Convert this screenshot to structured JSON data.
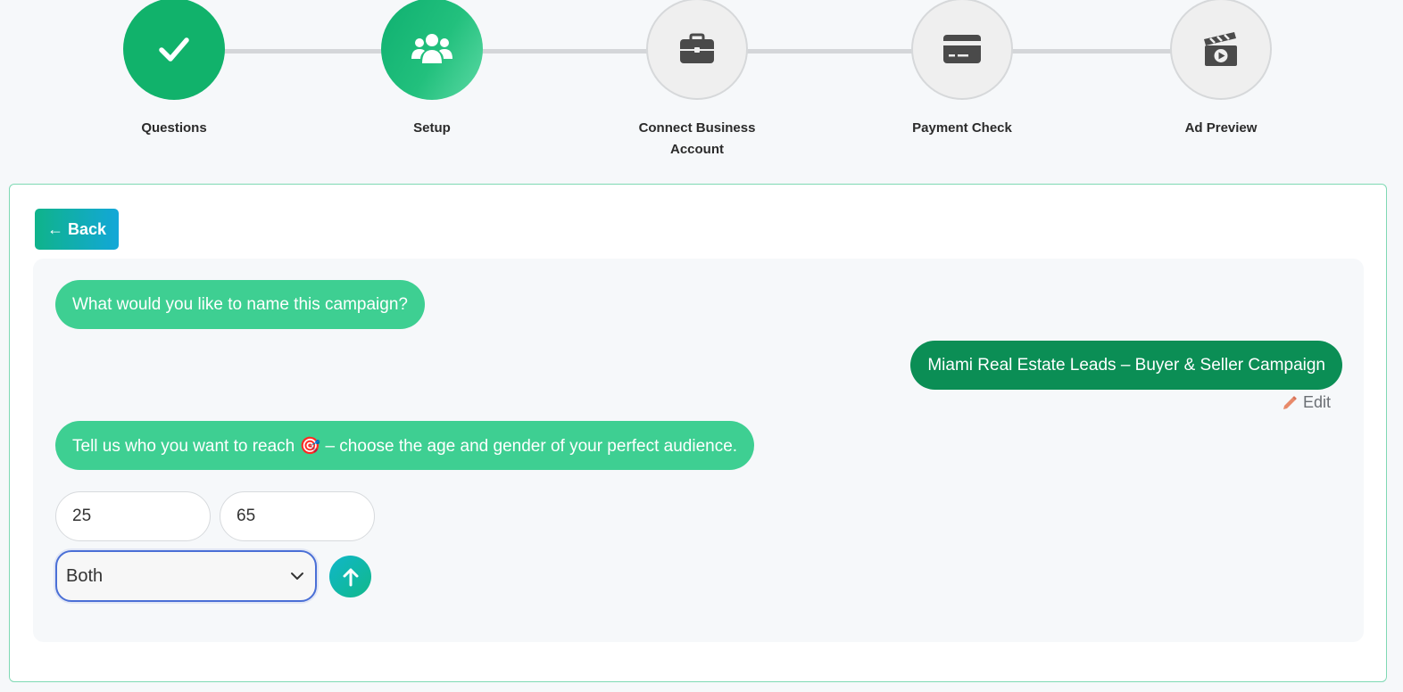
{
  "stepper": {
    "steps": [
      {
        "label": "Questions",
        "status": "done",
        "icon": "check-icon"
      },
      {
        "label": "Setup",
        "status": "active",
        "icon": "users-icon"
      },
      {
        "label": "Connect Business Account",
        "status": "pending",
        "icon": "briefcase-icon"
      },
      {
        "label": "Payment Check",
        "status": "pending",
        "icon": "credit-card-icon"
      },
      {
        "label": "Ad Preview",
        "status": "pending",
        "icon": "clapperboard-icon"
      }
    ]
  },
  "back_button": {
    "label": "← Back"
  },
  "chat": {
    "question_1": "What would you like to name this campaign?",
    "answer_1": "Miami Real Estate Leads – Buyer & Seller Campaign",
    "edit_label": "Edit",
    "question_2": "Tell us who you want to reach 🎯 – choose the age and gender of your perfect audience."
  },
  "form": {
    "age_min": "25",
    "age_max": "65",
    "gender_selected": "Both",
    "submit_icon": "arrow-up-icon"
  },
  "colors": {
    "accent_green": "#11b26b",
    "bubble_question": "#3ecf92",
    "bubble_answer": "#0b8e55",
    "pending_gray": "#efefef",
    "card_border": "#7fd9b4"
  }
}
